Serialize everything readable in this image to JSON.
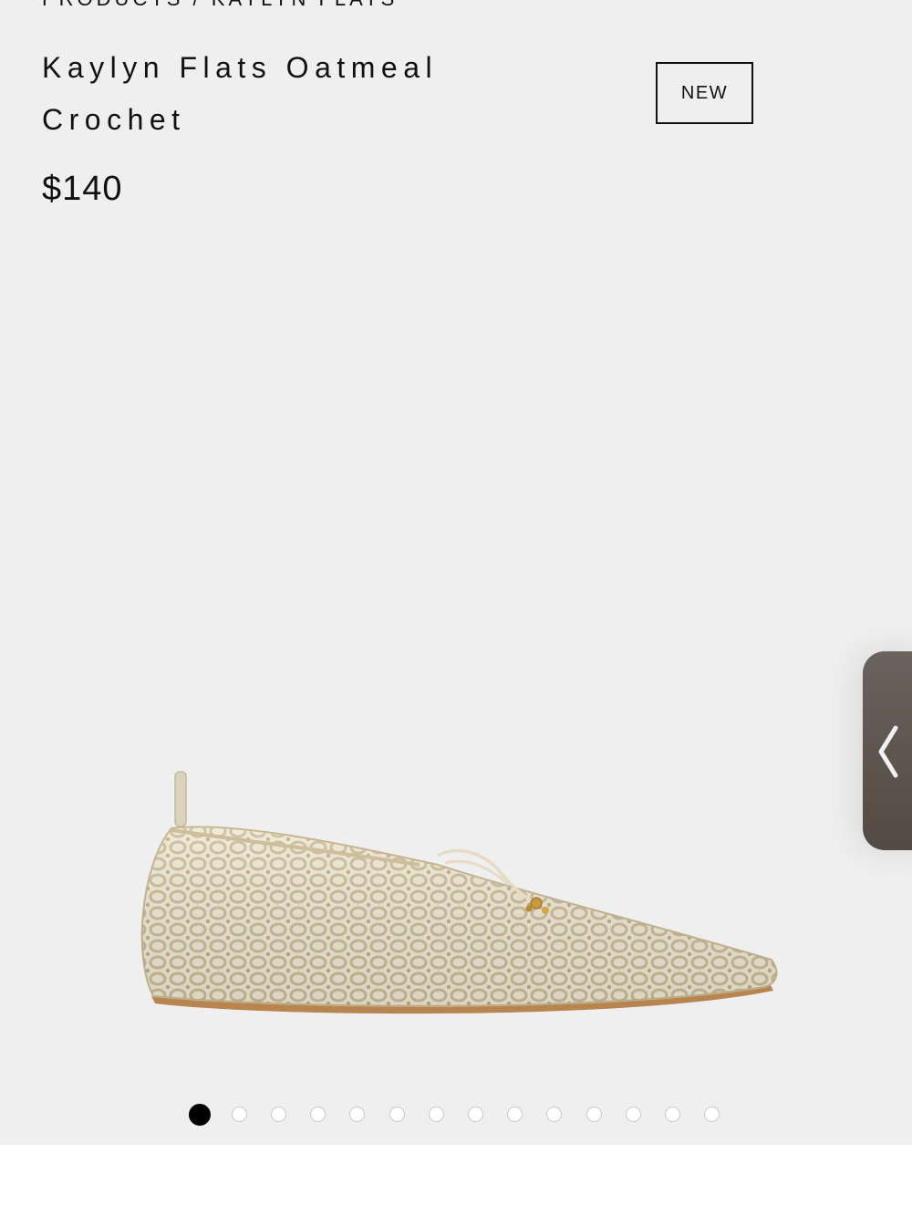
{
  "breadcrumb": "PRODUCTS / KAYLYN FLATS",
  "product": {
    "title": "Kaylyn Flats Oatmeal Crochet",
    "price": "$140",
    "badge": "NEW",
    "image_icon": "crochet-flat-shoe",
    "shoe_color": "#d8ccae",
    "sole_color": "#b8844f"
  },
  "carousel": {
    "total_images": 14,
    "active_index": 0
  },
  "side_tab": {
    "icon": "chevron-left-icon"
  },
  "colors": {
    "background": "#efefef",
    "text": "#111111",
    "active_dot": "#000000"
  }
}
